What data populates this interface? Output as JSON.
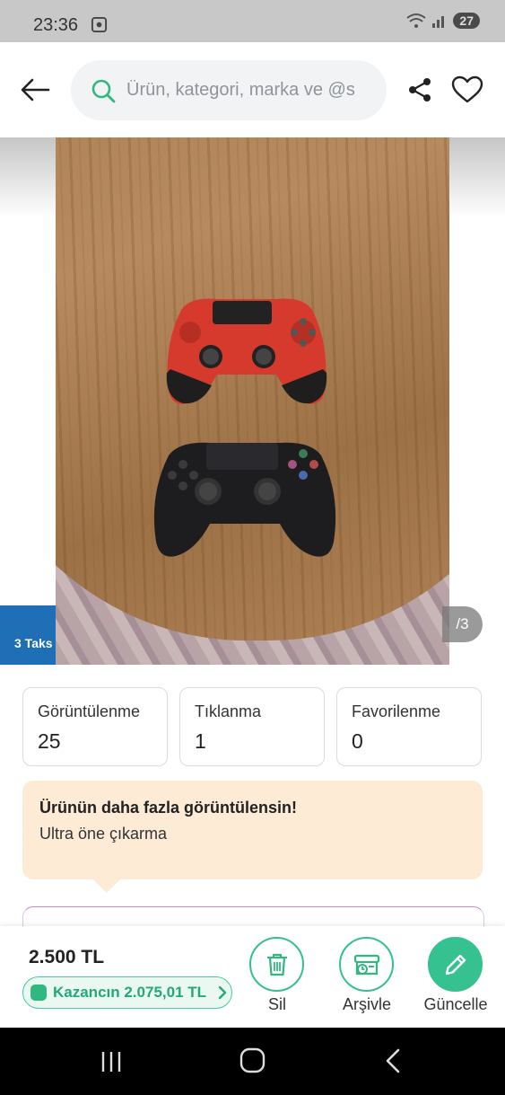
{
  "status": {
    "time": "23:36",
    "battery": "27"
  },
  "header": {
    "search_placeholder": "Ürün, kategori, marka ve @s"
  },
  "gallery": {
    "pager": "/3",
    "installment_badge": "3 Taks"
  },
  "stats": [
    {
      "label": "Görüntülenme",
      "value": "25"
    },
    {
      "label": "Tıklanma",
      "value": "1"
    },
    {
      "label": "Favorilenme",
      "value": "0"
    }
  ],
  "promo": {
    "title": "Ürünün daha fazla görüntülensin!",
    "subtitle": "Ultra öne çıkarma"
  },
  "bottom": {
    "price": "2.500 TL",
    "earnings": "Kazancın 2.075,01 TL",
    "actions": [
      {
        "label": "Sil",
        "icon": "trash-icon"
      },
      {
        "label": "Arşivle",
        "icon": "archive-icon"
      },
      {
        "label": "Güncelle",
        "icon": "pencil-icon"
      }
    ]
  },
  "colors": {
    "accent": "#35c290",
    "promo_bg": "#fdebd6",
    "badge": "#1f6fb6"
  }
}
